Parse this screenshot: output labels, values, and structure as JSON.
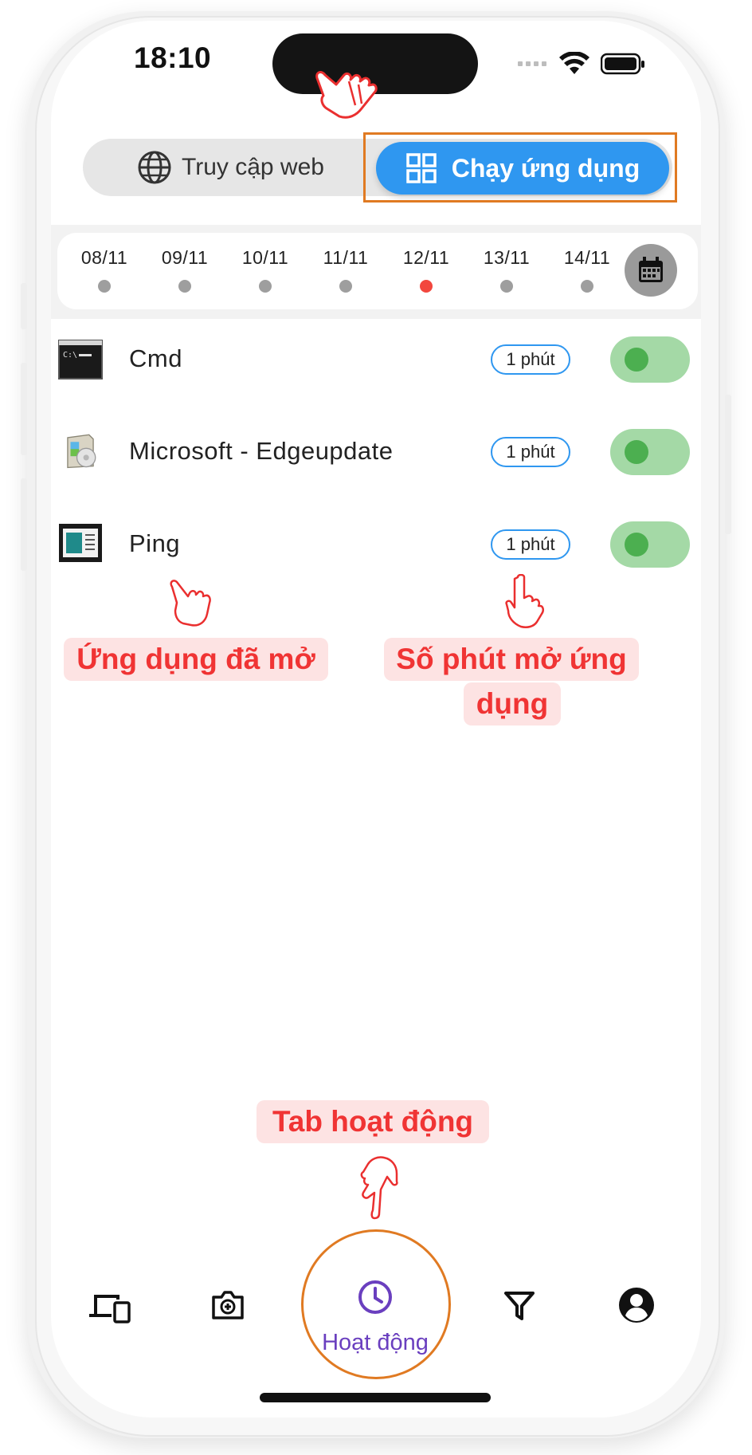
{
  "status_bar": {
    "time": "18:10"
  },
  "segment": {
    "web_label": "Truy cập web",
    "app_label": "Chạy ứng dụng",
    "selected": "app"
  },
  "dates": {
    "items": [
      "08/11",
      "09/11",
      "10/11",
      "11/11",
      "12/11",
      "13/11",
      "14/11"
    ],
    "selected": "12/11"
  },
  "apps": [
    {
      "name": "Cmd",
      "duration": "1 phút",
      "enabled": true,
      "icon": "cmd-icon"
    },
    {
      "name": "Microsoft - Edgeupdate",
      "duration": "1 phút",
      "enabled": true,
      "icon": "edgeupdate-icon"
    },
    {
      "name": "Ping",
      "duration": "1 phút",
      "enabled": true,
      "icon": "ping-icon"
    }
  ],
  "annotations": {
    "opened_apps": "Ứng dụng đã mở",
    "minutes_line1": "Số phút mở ứng",
    "minutes_line2": "dụng",
    "activity_tab": "Tab hoạt động"
  },
  "tabbar": {
    "items": [
      "devices-icon",
      "camera-icon",
      "clock-icon",
      "filter-icon",
      "account-icon"
    ],
    "active_label": "Hoạt động"
  },
  "colors": {
    "accent_blue": "#2f97f0",
    "active_purple": "#6a3fbf",
    "toggle_green": "#4caf50",
    "annotation_red": "#f03434",
    "highlight_orange": "#e07a22",
    "selected_dot_red": "#f2473e"
  }
}
